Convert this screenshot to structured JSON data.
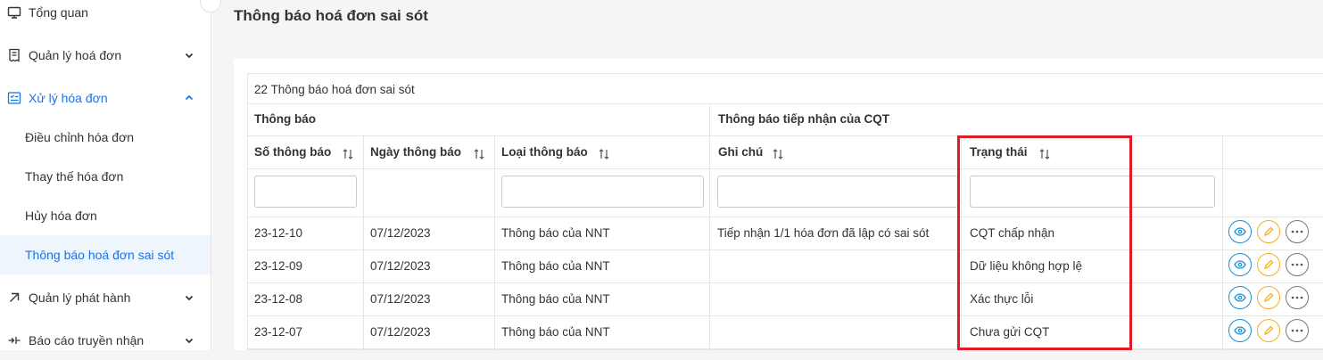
{
  "sidebar": {
    "items": [
      {
        "label": "Tổng quan",
        "icon": "monitor-icon"
      },
      {
        "label": "Quản lý hoá đơn",
        "icon": "receipt-icon"
      },
      {
        "label": "Xử lý hóa đơn",
        "icon": "checklist-icon"
      },
      {
        "label": "Quản lý phát hành",
        "icon": "arrow-up-right-icon"
      },
      {
        "label": "Báo cáo truyền nhận",
        "icon": "transfer-icon"
      }
    ],
    "subitems": [
      {
        "label": "Điều chỉnh hóa đơn"
      },
      {
        "label": "Thay thế hóa đơn"
      },
      {
        "label": "Hủy hóa đơn"
      },
      {
        "label": "Thông báo hoá đơn sai sót"
      }
    ]
  },
  "page": {
    "title": "Thông báo hoá đơn sai sót"
  },
  "table": {
    "caption": "22 Thông báo hoá đơn sai sót",
    "groups": [
      "Thông báo",
      "Thông báo tiếp nhận của CQT"
    ],
    "columns": [
      "Số thông báo",
      "Ngày thông báo",
      "Loại thông báo",
      "Ghi chú",
      "Trạng thái"
    ],
    "rows": [
      {
        "so": "23-12-10",
        "ngay": "07/12/2023",
        "loai": "Thông báo của NNT",
        "ghichu": "Tiếp nhận 1/1 hóa đơn đã lập có sai sót",
        "trangthai": "CQT chấp nhận"
      },
      {
        "so": "23-12-09",
        "ngay": "07/12/2023",
        "loai": "Thông báo của NNT",
        "ghichu": "",
        "trangthai": "Dữ liệu không hợp lệ"
      },
      {
        "so": "23-12-08",
        "ngay": "07/12/2023",
        "loai": "Thông báo của NNT",
        "ghichu": "",
        "trangthai": "Xác thực lỗi"
      },
      {
        "so": "23-12-07",
        "ngay": "07/12/2023",
        "loai": "Thông báo của NNT",
        "ghichu": "",
        "trangthai": "Chưa gửi CQT"
      }
    ]
  },
  "colors": {
    "accent": "#1a73e8",
    "highlight": "#e01b24",
    "view": "#1a8fd8",
    "edit": "#f2b01e"
  }
}
